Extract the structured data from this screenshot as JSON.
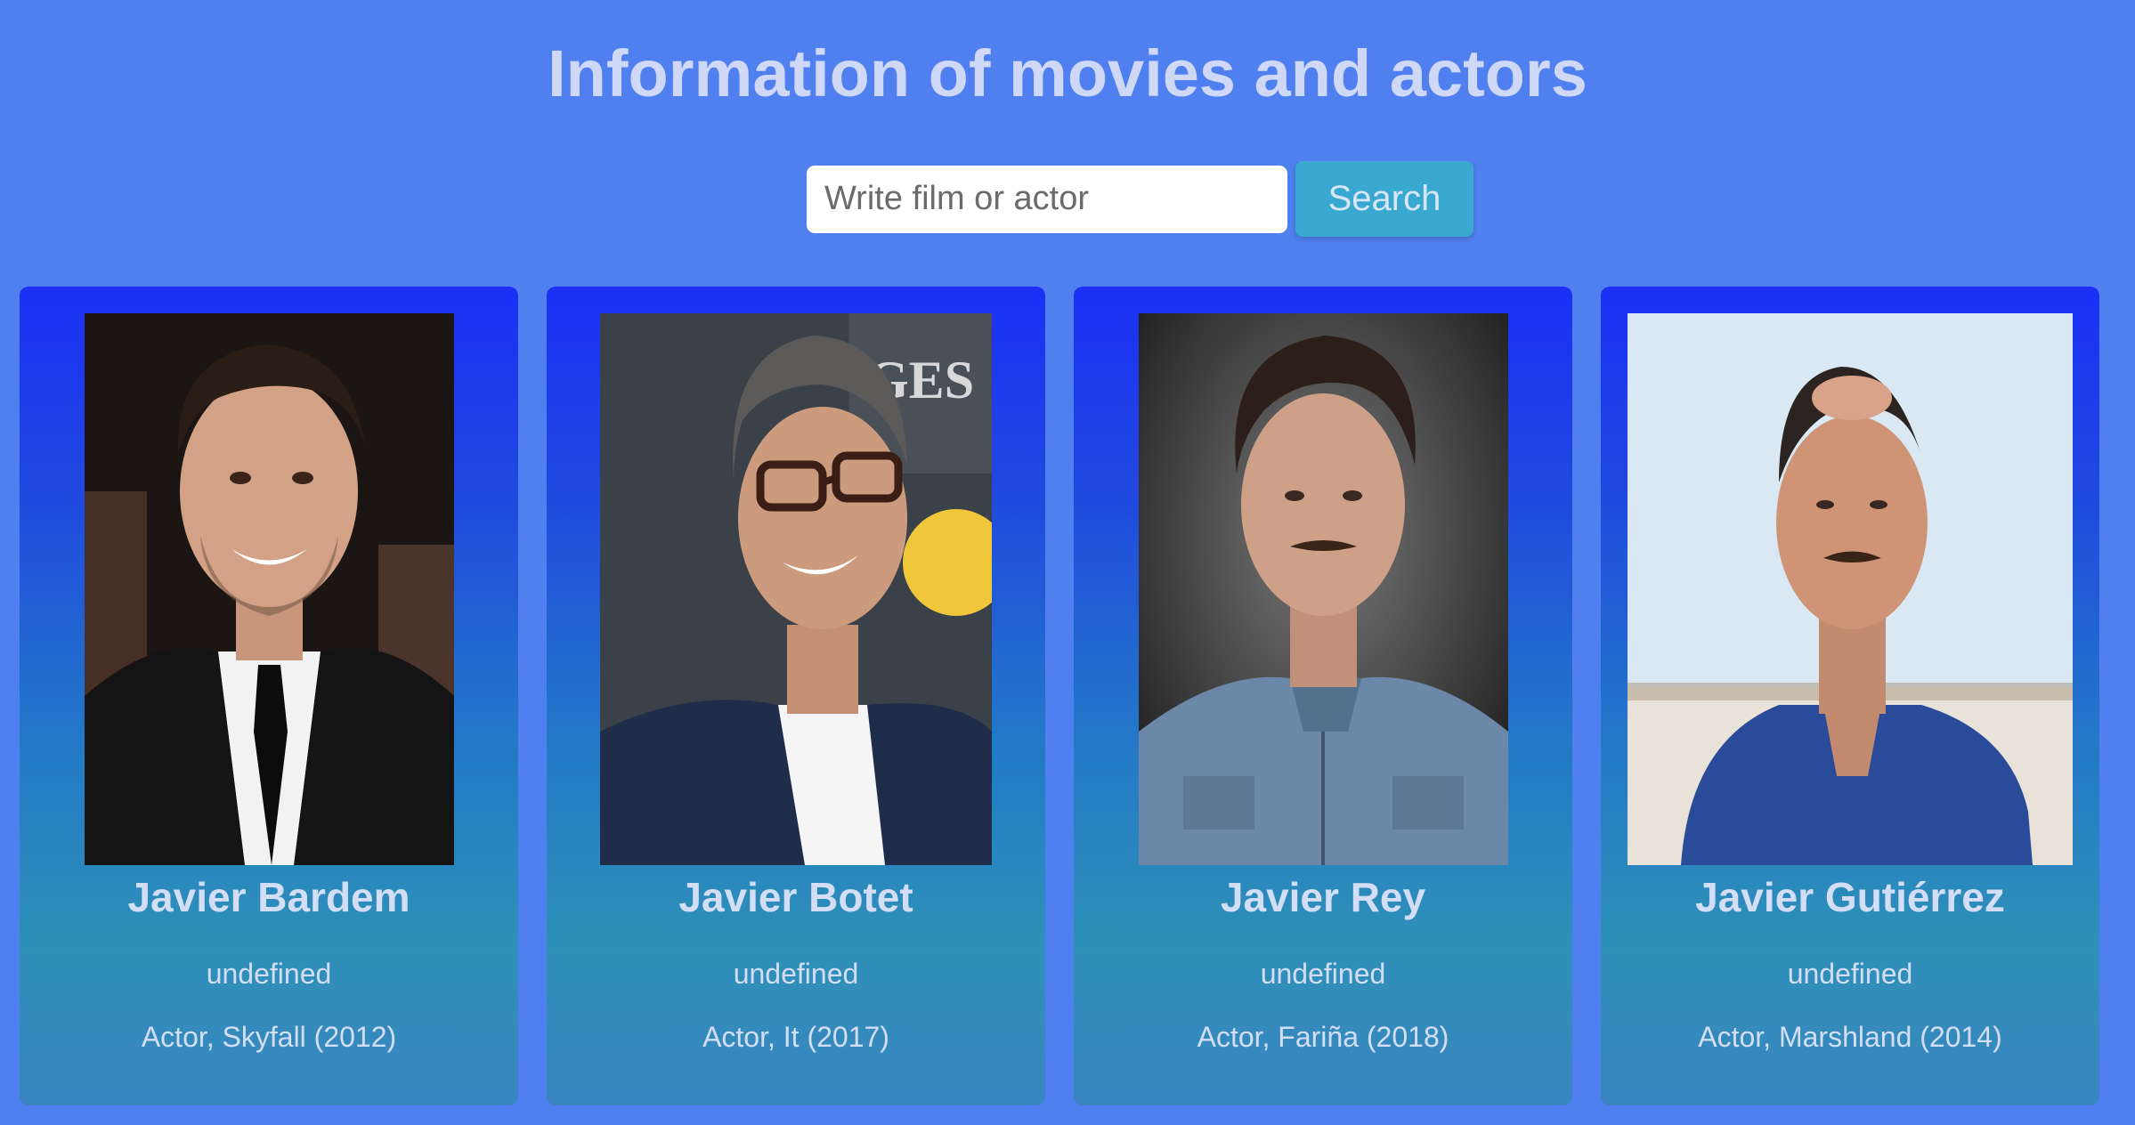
{
  "header": {
    "title": "Information of movies and actors"
  },
  "search": {
    "placeholder": "Write film or actor",
    "value": "",
    "button_label": "Search"
  },
  "colors": {
    "background": "#5080f0",
    "card_top": "#1a30f5",
    "card_bottom": "#3a86c0",
    "search_button": "#3aa9d2"
  },
  "actors": [
    {
      "name": "Javier Bardem",
      "line1": "undefined",
      "line2": "Actor, Skyfall (2012)",
      "photo": "actor-portrait"
    },
    {
      "name": "Javier Botet",
      "line1": "undefined",
      "line2": "Actor, It (2017)",
      "photo": "actor-portrait"
    },
    {
      "name": "Javier Rey",
      "line1": "undefined",
      "line2": "Actor, Fariña (2018)",
      "photo": "actor-portrait"
    },
    {
      "name": "Javier Gutiérrez",
      "line1": "undefined",
      "line2": "Actor, Marshland (2014)",
      "photo": "actor-portrait"
    }
  ]
}
